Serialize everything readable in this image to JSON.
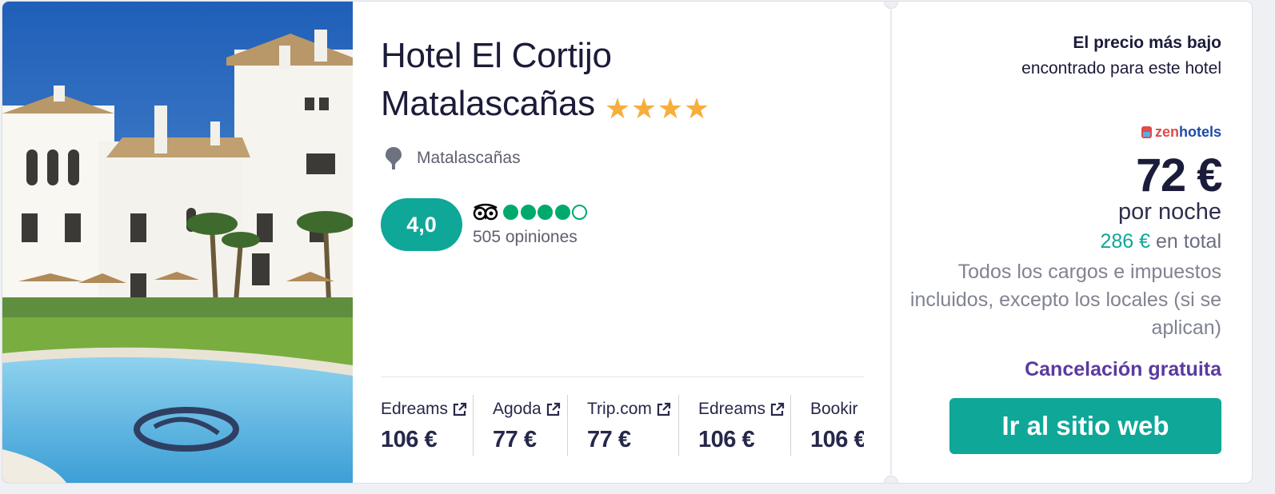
{
  "hotel": {
    "name_line1": "Hotel El Cortijo",
    "name_line2": "Matalascañas",
    "stars": 4,
    "location": "Matalascañas",
    "photo_alt": "hotel-photo"
  },
  "rating": {
    "score": "4,0",
    "tripadvisor_bubbles": 4,
    "tripadvisor_max": 5,
    "reviews": "505 opiniones"
  },
  "providers": [
    {
      "name": "Edreams",
      "price": "106 €"
    },
    {
      "name": "Agoda",
      "price": "77 €"
    },
    {
      "name": "Trip.com",
      "price": "77 €"
    },
    {
      "name": "Edreams",
      "price": "106 €"
    },
    {
      "name": "Bookir",
      "price": "106 €"
    }
  ],
  "offer": {
    "lowest_bold": "El precio más bajo",
    "lowest_sub": "encontrado para este hotel",
    "brand_part1": "zen",
    "brand_part2": "hotels",
    "price": "72 €",
    "per_night": "por noche",
    "total_amount": "286 €",
    "total_label": " en total",
    "taxes": "Todos los cargos e impuestos incluidos, excepto los locales (si se aplican)",
    "cancellation": "Cancelación gratuita",
    "cta": "Ir al sitio web"
  },
  "colors": {
    "accent": "#0ea798",
    "star": "#f6ae3c",
    "tripadvisor": "#00aa6c",
    "cancellation": "#5a3aa0",
    "text": "#1b1b3a"
  }
}
